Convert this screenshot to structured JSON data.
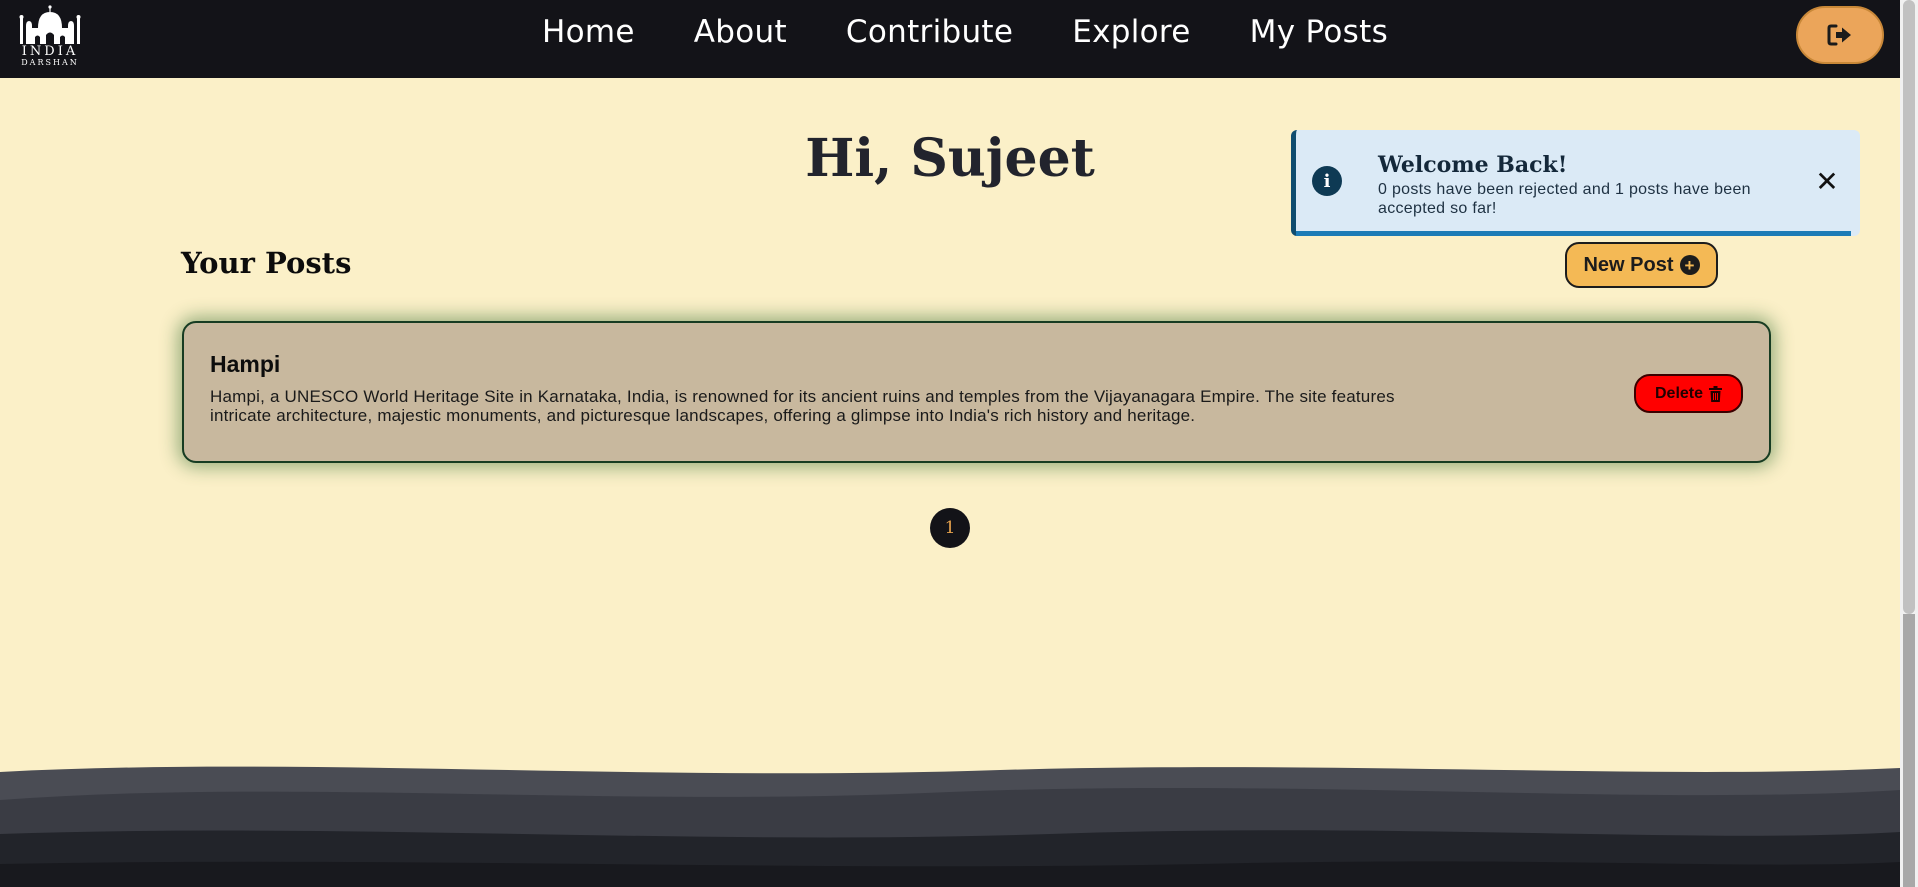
{
  "navbar": {
    "logo_line1": "INDIA",
    "logo_line2": "DARSHAN",
    "links": [
      "Home",
      "About",
      "Contribute",
      "Explore",
      "My Posts"
    ]
  },
  "greeting": "Hi, Sujeet",
  "section_title": "Your Posts",
  "new_post_label": "New Post",
  "toast": {
    "title": "Welcome Back!",
    "message": "0 posts have been rejected and 1 posts have been accepted so far!"
  },
  "posts": [
    {
      "title": "Hampi",
      "description": "Hampi, a UNESCO World Heritage Site in Karnataka, India, is renowned for its ancient ruins and temples from the Vijayanagara Empire. The site features intricate architecture, majestic monuments, and picturesque landscapes, offering a glimpse into India's rich history and heritage.",
      "delete_label": "Delete"
    }
  ],
  "pagination": {
    "current_page": "1"
  },
  "colors": {
    "page_bg": "#fbf0c8",
    "nav_bg": "#131318",
    "accent_orange": "#eba55a",
    "delete_red": "#ff0000",
    "toast_bg": "#dbeaf6"
  },
  "icons": {
    "logout": "sign-out-icon",
    "info": "info-icon",
    "close": "close-icon",
    "plus": "plus-circle-icon",
    "trash": "trash-icon"
  }
}
